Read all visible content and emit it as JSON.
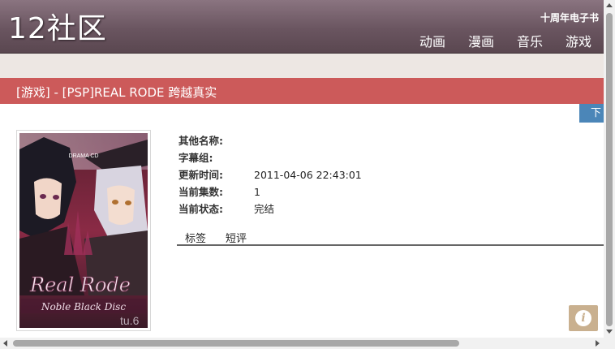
{
  "header": {
    "logo": "12社区",
    "ebook_link": "十周年电子书",
    "nav": [
      "动画",
      "漫画",
      "音乐",
      "游戏"
    ]
  },
  "title": "[游戏] - [PSP]REAL RODE 跨越真实",
  "download_label": "下",
  "cover": {
    "badge": "DRAMA CD",
    "title_line1": "Real Rode",
    "title_line2": "Noble Black Disc",
    "watermark": "tu.6"
  },
  "info": [
    {
      "label": "其他名称:",
      "value": ""
    },
    {
      "label": "字幕组:",
      "value": ""
    },
    {
      "label": "更新时间:",
      "value": "2011-04-06 22:43:01"
    },
    {
      "label": "当前集数:",
      "value": "1"
    },
    {
      "label": "当前状态:",
      "value": "完结"
    }
  ],
  "tabs": [
    "标签",
    "短评"
  ],
  "info_button": "i"
}
